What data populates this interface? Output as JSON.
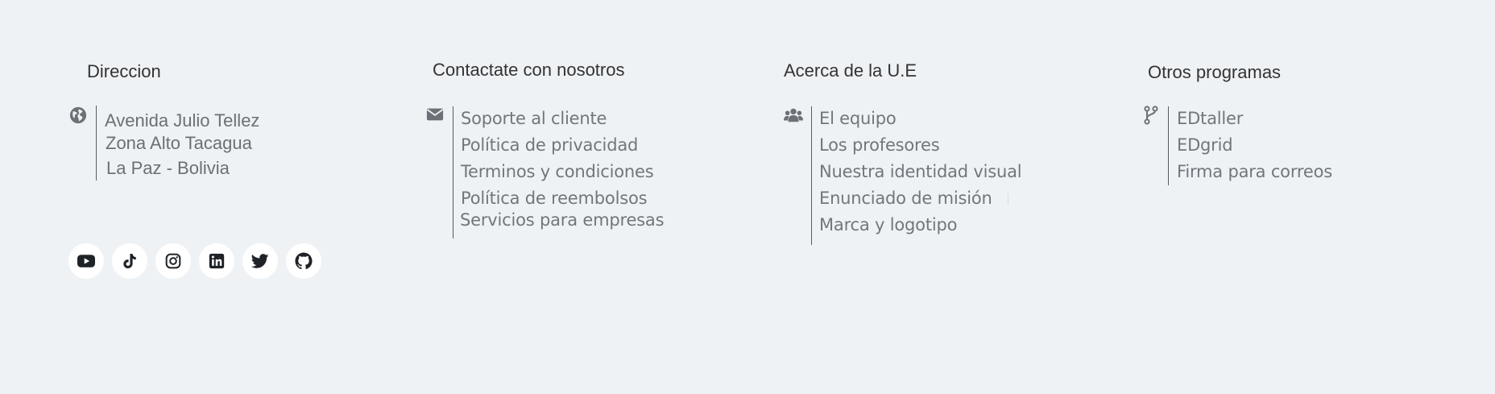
{
  "direccion": {
    "heading": "Direccion",
    "icon": "globe-icon",
    "lines": [
      "Avenida Julio Tellez",
      "Zona Alto Tacagua",
      "La Paz - Bolivia"
    ]
  },
  "contacto": {
    "heading": "Contactate con nosotros",
    "icon": "envelope-icon",
    "links": [
      "Soporte al cliente",
      "Política de privacidad",
      "Terminos y condiciones",
      "Política de reembolsos",
      "Servicios para empresas"
    ]
  },
  "acerca": {
    "heading": "Acerca de la U.E",
    "icon": "users-icon",
    "links": [
      "El equipo",
      "Los profesores",
      "Nuestra identidad visual",
      "Enunciado de misión",
      "Marca y logotipo"
    ]
  },
  "otros": {
    "heading": "Otros programas",
    "icon": "code-branch-icon",
    "links": [
      "EDtaller",
      "EDgrid",
      "Firma para correos"
    ]
  },
  "social": [
    {
      "name": "youtube-icon"
    },
    {
      "name": "tiktok-icon"
    },
    {
      "name": "instagram-icon"
    },
    {
      "name": "linkedin-icon"
    },
    {
      "name": "twitter-icon"
    },
    {
      "name": "github-icon"
    }
  ],
  "colors": {
    "background": "#eff2f5",
    "heading": "#333333",
    "link": "#72767c",
    "divider": "#555b63",
    "icon": "#6c7178",
    "social_bg": "#ffffff",
    "social_icon": "#1f2328"
  }
}
